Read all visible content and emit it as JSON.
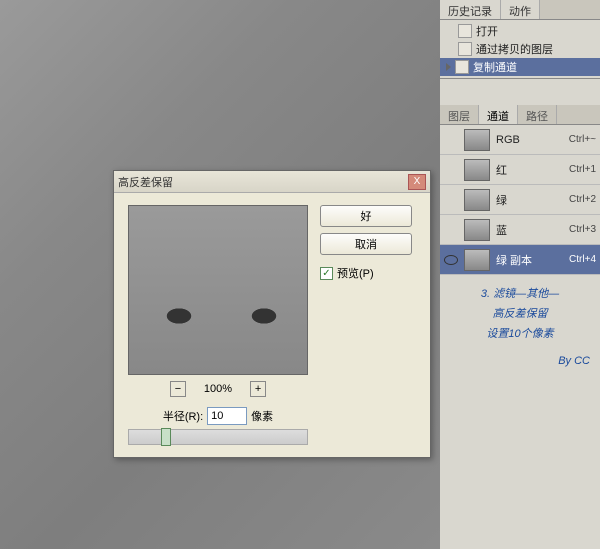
{
  "history": {
    "tabs": [
      "历史记录",
      "动作"
    ],
    "items": [
      {
        "label": "打开"
      },
      {
        "label": "通过拷贝的图层"
      },
      {
        "label": "复制通道"
      }
    ]
  },
  "channels": {
    "tabs": [
      "图层",
      "通道",
      "路径"
    ],
    "rows": [
      {
        "name": "RGB",
        "shortcut": "Ctrl+~"
      },
      {
        "name": "红",
        "shortcut": "Ctrl+1"
      },
      {
        "name": "绿",
        "shortcut": "Ctrl+2"
      },
      {
        "name": "蓝",
        "shortcut": "Ctrl+3"
      },
      {
        "name": "绿 副本",
        "shortcut": "Ctrl+4"
      }
    ]
  },
  "annotation": {
    "line1": "3. 滤镜—其他—",
    "line2": "高反差保留",
    "line3": "设置10个像素",
    "by": "By  CC"
  },
  "dialog": {
    "title": "高反差保留",
    "ok": "好",
    "cancel": "取消",
    "preview_label": "预览(P)",
    "zoom": "100%",
    "minus": "−",
    "plus": "+",
    "radius_label": "半径(R):",
    "radius_value": "10",
    "radius_unit": "像素",
    "close": "X"
  }
}
